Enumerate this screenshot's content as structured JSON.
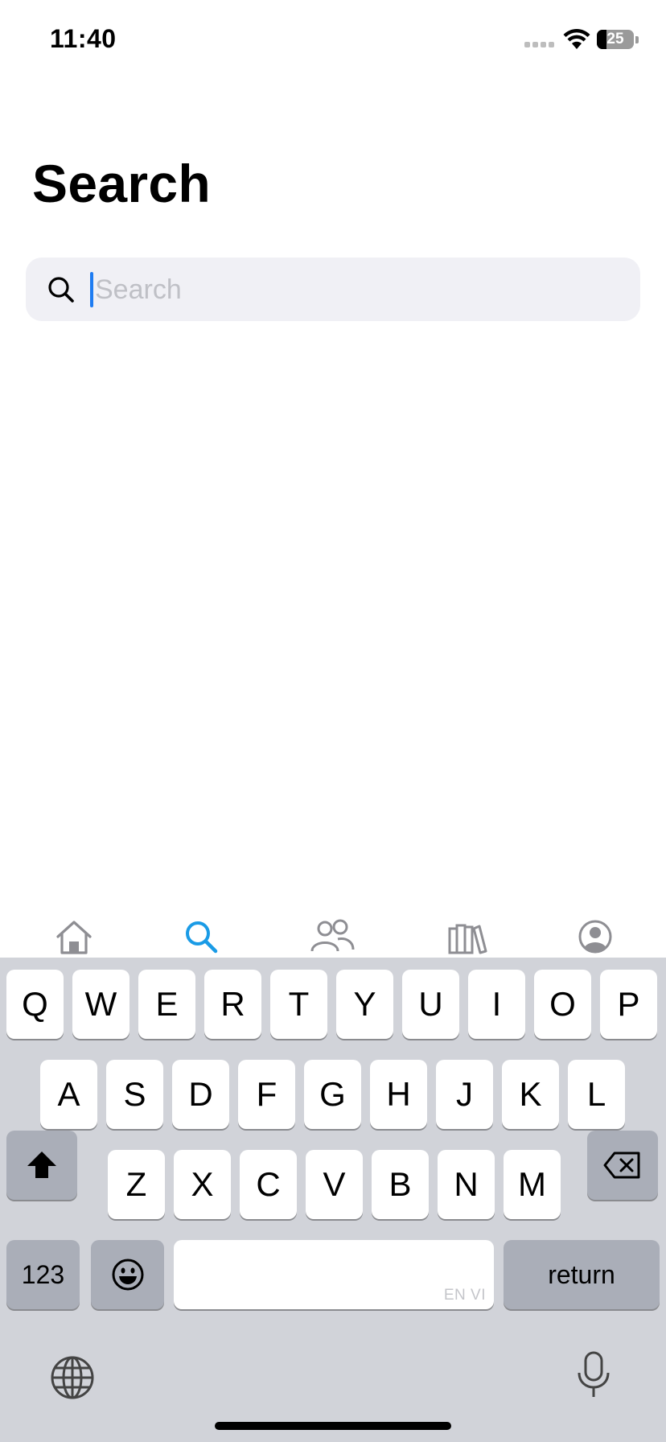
{
  "status_bar": {
    "time": "11:40",
    "battery_level": "25",
    "battery_percent": 25
  },
  "title": "Search",
  "search": {
    "placeholder": "Search",
    "value": ""
  },
  "tab_bar": {
    "active_color": "#1a9be6",
    "inactive_color": "#8e8e93",
    "items": [
      {
        "icon": "home-icon",
        "active": false
      },
      {
        "icon": "search-icon",
        "active": true
      },
      {
        "icon": "people-icon",
        "active": false
      },
      {
        "icon": "library-icon",
        "active": false
      },
      {
        "icon": "profile-icon",
        "active": false
      }
    ]
  },
  "keyboard": {
    "row1": [
      "Q",
      "W",
      "E",
      "R",
      "T",
      "Y",
      "U",
      "I",
      "O",
      "P"
    ],
    "row2": [
      "A",
      "S",
      "D",
      "F",
      "G",
      "H",
      "J",
      "K",
      "L"
    ],
    "row3": [
      "Z",
      "X",
      "C",
      "V",
      "B",
      "N",
      "M"
    ],
    "numbers_label": "123",
    "return_label": "return",
    "space_hint": "EN VI",
    "icons": [
      "shift-icon",
      "backspace-icon",
      "emoji-icon",
      "globe-icon",
      "microphone-icon"
    ]
  }
}
